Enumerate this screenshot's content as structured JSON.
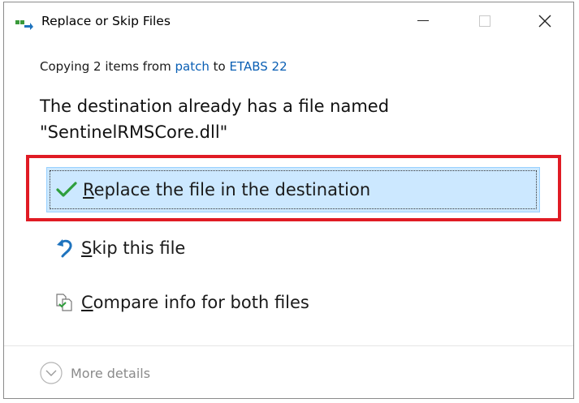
{
  "window": {
    "title": "Replace or Skip Files"
  },
  "copying": {
    "prefix": "Copying 2 items from",
    "source": "patch",
    "middle": "to",
    "destination": "ETABS 22"
  },
  "message": {
    "line1": "The destination already has a file named",
    "line2": "\"SentinelRMSCore.dll\""
  },
  "options": {
    "replace": {
      "mnemonic": "R",
      "rest": "eplace the file in the destination"
    },
    "skip": {
      "mnemonic": "S",
      "rest": "kip this file"
    },
    "compare": {
      "mnemonic": "C",
      "rest": "ompare info for both files"
    }
  },
  "footer": {
    "more_details": "More details"
  },
  "colors": {
    "accent": "#0a5fb4",
    "selected_bg": "#cce8ff",
    "highlight": "#e01b24",
    "check": "#2e9e3c"
  },
  "icons": {
    "app": "copy-files-icon",
    "replace": "checkmark-icon",
    "skip": "skip-arrow-icon",
    "compare": "compare-files-icon",
    "more": "chevron-down-circle-icon"
  }
}
